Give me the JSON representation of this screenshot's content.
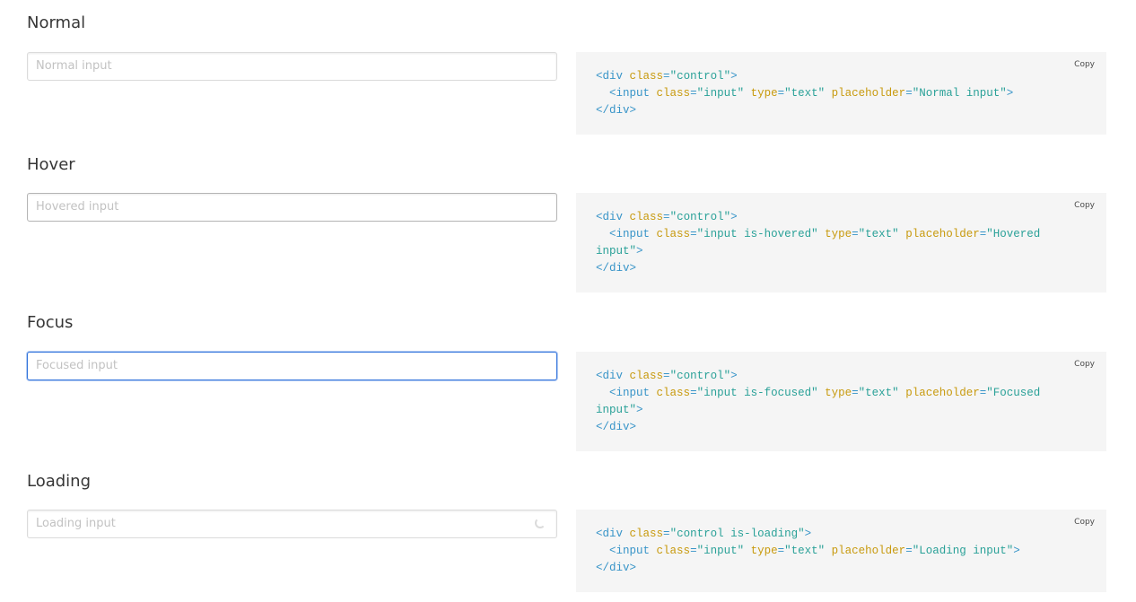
{
  "sections": [
    {
      "title": "Normal",
      "placeholder": "Normal input",
      "copy_label": "Copy",
      "code": {
        "open_div": "<div",
        "div_attr": "class",
        "eq1": "=",
        "div_val": "\"control\"",
        "close1": ">",
        "input_open": "<input",
        "a1": "class",
        "v1": "\"input\"",
        "a2": "type",
        "v2": "\"text\"",
        "a3": "placeholder",
        "v3": "\"Normal input\"",
        "input_close": ">",
        "end_div": "</div>"
      }
    },
    {
      "title": "Hover",
      "placeholder": "Hovered input",
      "copy_label": "Copy",
      "code": {
        "open_div": "<div",
        "div_attr": "class",
        "eq1": "=",
        "div_val": "\"control\"",
        "close1": ">",
        "input_open": "<input",
        "a1": "class",
        "v1": "\"input is-hovered\"",
        "a2": "type",
        "v2": "\"text\"",
        "a3": "placeholder",
        "v3": "\"Hovered input\"",
        "input_close": ">",
        "end_div": "</div>"
      }
    },
    {
      "title": "Focus",
      "placeholder": "Focused input",
      "copy_label": "Copy",
      "code": {
        "open_div": "<div",
        "div_attr": "class",
        "eq1": "=",
        "div_val": "\"control\"",
        "close1": ">",
        "input_open": "<input",
        "a1": "class",
        "v1": "\"input is-focused\"",
        "a2": "type",
        "v2": "\"text\"",
        "a3": "placeholder",
        "v3": "\"Focused input\"",
        "input_close": ">",
        "end_div": "</div>"
      }
    },
    {
      "title": "Loading",
      "placeholder": "Loading input",
      "copy_label": "Copy",
      "code": {
        "open_div": "<div",
        "div_attr": "class",
        "eq1": "=",
        "div_val": "\"control is-loading\"",
        "close1": ">",
        "input_open": "<input",
        "a1": "class",
        "v1": "\"input\"",
        "a2": "type",
        "v2": "\"text\"",
        "a3": "placeholder",
        "v3": "\"Loading input\"",
        "input_close": ">",
        "end_div": "</div>"
      }
    }
  ],
  "colors": {
    "focus_border": "#3273dc",
    "code_background": "#f5f5f5",
    "tag": "#3794c8",
    "attribute": "#c89a0e",
    "value": "#2aa198"
  },
  "icons": {
    "loading": "loading-spinner-icon"
  }
}
